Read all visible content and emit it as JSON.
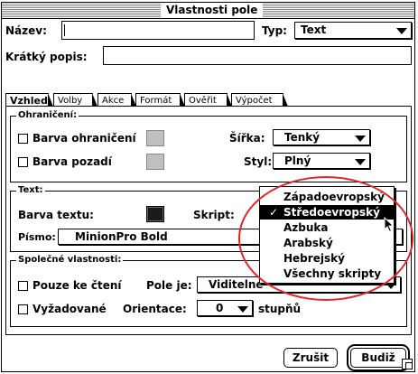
{
  "window": {
    "title": "Vlastnosti pole"
  },
  "top": {
    "name_label": "Název:",
    "name_value": "",
    "type_label": "Typ:",
    "type_value": "Text",
    "tooltip_label": "Krátký popis:",
    "tooltip_value": ""
  },
  "tabs": [
    {
      "label": "Vzhled",
      "active": true
    },
    {
      "label": "Volby"
    },
    {
      "label": "Akce"
    },
    {
      "label": "Formát"
    },
    {
      "label": "Ověřit"
    },
    {
      "label": "Výpočet"
    }
  ],
  "border_group": {
    "label": "Ohraničení:",
    "border_color_label": "Barva ohraničení",
    "background_color_label": "Barva pozadí",
    "width_label": "Šířka:",
    "width_value": "Tenký",
    "style_label": "Styl:",
    "style_value": "Plný"
  },
  "text_group": {
    "label": "Text:",
    "text_color_label": "Barva textu:",
    "script_label": "Skript:",
    "font_label": "Písmo:",
    "font_value": "MinionPro Bold"
  },
  "script_menu": {
    "items": [
      {
        "label": "Západoevropský"
      },
      {
        "label": "Středoevropský",
        "selected": true
      },
      {
        "label": "Azbuka"
      },
      {
        "label": "Arabský"
      },
      {
        "label": "Hebrejský"
      },
      {
        "label": "Všechny skripty"
      }
    ],
    "check_glyph": "✓"
  },
  "common_group": {
    "label": "Společné vlastnosti:",
    "readonly_label": "Pouze ke čtení",
    "field_is_label": "Pole je:",
    "field_is_value": "Viditelné",
    "required_label": "Vyžadované",
    "orientation_label": "Orientace:",
    "orientation_value": "0",
    "degrees_label": "stupňů"
  },
  "buttons": {
    "cancel": "Zrušit",
    "ok": "Budiž"
  },
  "colors": {
    "highlight_ellipse": "#e3242b",
    "selection": "#000000"
  }
}
